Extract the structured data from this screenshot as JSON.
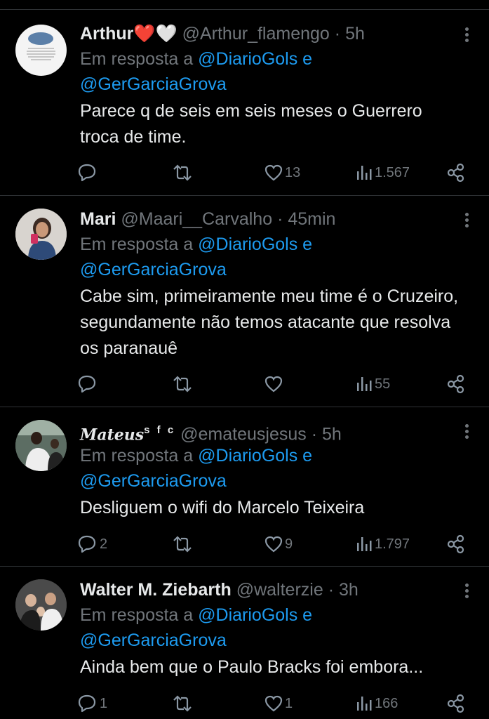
{
  "tweets": [
    {
      "name": "Arthur",
      "name_suffix": "❤️🤍",
      "handle": "@Arthur_flamengo",
      "time": "5h",
      "reply_prefix": "Em resposta a",
      "reply_mention1": "@DiarioGols",
      "reply_conj": "e",
      "reply_mention2": "@GerGarciaGrova",
      "text": "Parece q de seis em seis meses o Guerrero troca de time.",
      "replies": "",
      "retweets": "",
      "likes": "13",
      "views": "1.567"
    },
    {
      "name": "Mari",
      "handle": "@Maari__Carvalho",
      "time": "45min",
      "reply_prefix": "Em resposta a",
      "reply_mention1": "@DiarioGols",
      "reply_conj": "e",
      "reply_mention2": "@GerGarciaGrova",
      "text": "Cabe sim, primeiramente meu time é o Cruzeiro, segundamente não temos atacante que resolva os paranauê",
      "replies": "",
      "retweets": "",
      "likes": "",
      "views": "55"
    },
    {
      "name": "Mateus",
      "name_suffix": "s f c",
      "handle": "@emateusjesus",
      "time": "5h",
      "reply_prefix": "Em resposta a",
      "reply_mention1": "@DiarioGols",
      "reply_conj": "e",
      "reply_mention2": "@GerGarciaGrova",
      "text": "Desliguem o wifi do Marcelo Teixeira",
      "replies": "2",
      "retweets": "",
      "likes": "9",
      "views": "1.797"
    },
    {
      "name": "Walter M. Ziebarth",
      "handle": "@walterzie",
      "time": "3h",
      "reply_prefix": "Em resposta a",
      "reply_mention1": "@DiarioGols",
      "reply_conj": "e",
      "reply_mention2": "@GerGarciaGrova",
      "text": "Ainda bem que o Paulo Bracks foi embora...",
      "replies": "1",
      "retweets": "",
      "likes": "1",
      "views": "166"
    }
  ],
  "icons": {
    "reply": "reply-icon",
    "retweet": "retweet-icon",
    "like": "heart-icon",
    "views": "views-icon",
    "share": "share-icon",
    "more": "more-icon"
  },
  "colors": {
    "background": "#000000",
    "text": "#e7e9ea",
    "muted": "#71767b",
    "link": "#1d9bf0",
    "divider": "#2f3336"
  }
}
